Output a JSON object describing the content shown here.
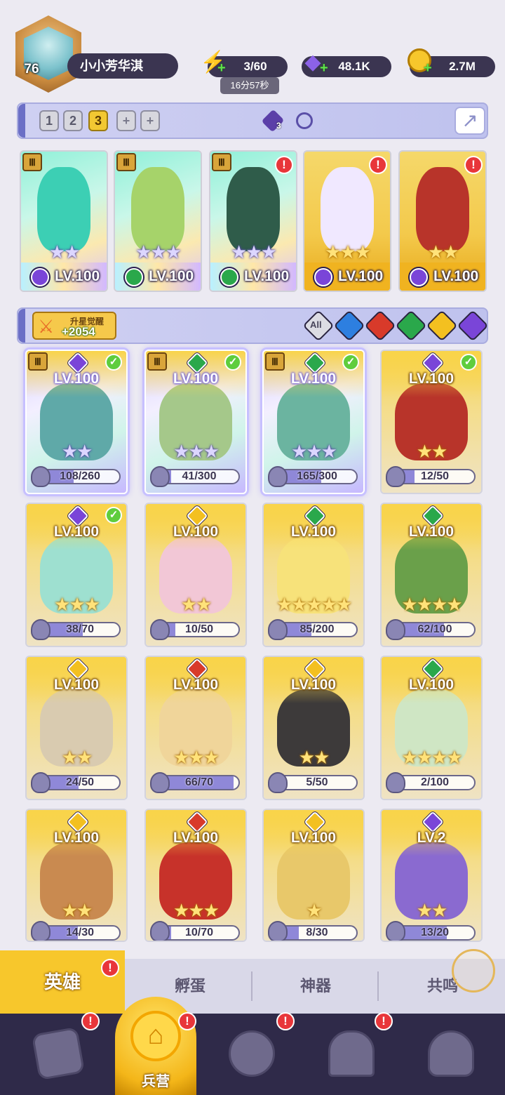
{
  "player": {
    "level": "76",
    "name": "小小芳华淇"
  },
  "resources": {
    "energy": {
      "value": "3/60",
      "timer": "16分57秒",
      "icon": "lightning-icon"
    },
    "gems": {
      "value": "48.1K",
      "icon": "diamond-icon"
    },
    "coins": {
      "value": "2.7M",
      "icon": "coin-icon"
    }
  },
  "team_bar": {
    "slots": [
      "1",
      "2",
      "3"
    ],
    "active_slot": "3",
    "add_icon": "+",
    "gem_count": "3"
  },
  "team": [
    {
      "level": "LV.100",
      "stars": "★★",
      "rank": "Ⅲ",
      "alert": "",
      "style": "holo",
      "element": "#7a45d8",
      "tint": "#3ccfb4"
    },
    {
      "level": "LV.100",
      "stars": "★★★",
      "rank": "Ⅲ",
      "alert": "",
      "style": "holo",
      "element": "#2aa84b",
      "tint": "#a6d36a"
    },
    {
      "level": "LV.100",
      "stars": "★★★",
      "rank": "Ⅲ",
      "alert": "!",
      "style": "holo",
      "element": "#2aa84b",
      "tint": "#2f5c4a"
    },
    {
      "level": "LV.100",
      "stars": "★★★",
      "rank": "",
      "alert": "!",
      "style": "gold",
      "element": "#7a45d8",
      "tint": "#f0e8ff"
    },
    {
      "level": "LV.100",
      "stars": "★★",
      "rank": "",
      "alert": "!",
      "style": "gold",
      "element": "#7a45d8",
      "tint": "#b8342a"
    }
  ],
  "filter_bar": {
    "awaken_label": "升星觉醒",
    "awaken_value": "+2054",
    "all_label": "All",
    "elements": [
      "#2d7fe0",
      "#d83a2a",
      "#2aa84b",
      "#f3c020",
      "#7a45d8"
    ]
  },
  "heroes": [
    {
      "level": "LV.100",
      "stars": "★★",
      "shards": "108/260",
      "fill": 0.42,
      "rank": "Ⅲ",
      "checked": true,
      "style": "holo",
      "element": "#7a45d8",
      "tint": "#5fa9a8"
    },
    {
      "level": "LV.100",
      "stars": "★★★",
      "shards": "41/300",
      "fill": 0.14,
      "rank": "Ⅲ",
      "checked": true,
      "style": "holo",
      "element": "#2aa84b",
      "tint": "#a5c88a"
    },
    {
      "level": "LV.100",
      "stars": "★★★",
      "shards": "165/300",
      "fill": 0.55,
      "rank": "Ⅲ",
      "checked": true,
      "style": "holo",
      "element": "#2aa84b",
      "tint": "#6bb4a0"
    },
    {
      "level": "LV.100",
      "stars": "★★",
      "shards": "12/50",
      "fill": 0.24,
      "rank": "",
      "checked": true,
      "style": "gold",
      "element": "#7a45d8",
      "tint": "#b8342a"
    },
    {
      "level": "LV.100",
      "stars": "★★★",
      "shards": "38/70",
      "fill": 0.54,
      "rank": "",
      "checked": true,
      "style": "gold",
      "element": "#7a45d8",
      "tint": "#9ee0d0"
    },
    {
      "level": "LV.100",
      "stars": "★★",
      "shards": "10/50",
      "fill": 0.2,
      "rank": "",
      "checked": false,
      "style": "gold",
      "element": "#f3c020",
      "tint": "#f2c7d6"
    },
    {
      "level": "LV.100",
      "stars": "★★★★★",
      "shards": "85/200",
      "fill": 0.43,
      "rank": "",
      "checked": false,
      "style": "gold",
      "element": "#2aa84b",
      "tint": "#f7e27a"
    },
    {
      "level": "LV.100",
      "stars": "★★★★",
      "shards": "62/100",
      "fill": 0.62,
      "rank": "",
      "checked": false,
      "style": "gold",
      "element": "#2aa84b",
      "tint": "#6aa04a"
    },
    {
      "level": "LV.100",
      "stars": "★★",
      "shards": "24/50",
      "fill": 0.48,
      "rank": "",
      "checked": false,
      "style": "gold",
      "element": "#f3c020",
      "tint": "#d9cbb0"
    },
    {
      "level": "LV.100",
      "stars": "★★★",
      "shards": "66/70",
      "fill": 0.94,
      "rank": "",
      "checked": false,
      "style": "gold",
      "element": "#d83a2a",
      "tint": "#f0d59a"
    },
    {
      "level": "LV.100",
      "stars": "★★",
      "shards": "5/50",
      "fill": 0.1,
      "rank": "",
      "checked": false,
      "style": "gold",
      "element": "#f3c020",
      "tint": "#3d3a3a"
    },
    {
      "level": "LV.100",
      "stars": "★★★★",
      "shards": "2/100",
      "fill": 0.02,
      "rank": "",
      "checked": false,
      "style": "gold",
      "element": "#2aa84b",
      "tint": "#cfe6c4"
    },
    {
      "level": "LV.100",
      "stars": "★★",
      "shards": "14/30",
      "fill": 0.47,
      "rank": "",
      "checked": false,
      "style": "gold",
      "element": "#f3c020",
      "tint": "#c98a50"
    },
    {
      "level": "LV.100",
      "stars": "★★★",
      "shards": "10/70",
      "fill": 0.14,
      "rank": "",
      "checked": false,
      "style": "gold",
      "element": "#d83a2a",
      "tint": "#c7322a"
    },
    {
      "level": "LV.100",
      "stars": "★",
      "shards": "8/30",
      "fill": 0.27,
      "rank": "",
      "checked": false,
      "style": "gold",
      "element": "#f3c020",
      "tint": "#e8c86a"
    },
    {
      "level": "LV.2",
      "stars": "★★",
      "shards": "13/20",
      "fill": 0.65,
      "rank": "",
      "checked": false,
      "style": "gold",
      "element": "#7a45d8",
      "tint": "#8a6ad0"
    }
  ],
  "subtabs": [
    {
      "label": "英雄",
      "active": true,
      "alert": "!"
    },
    {
      "label": "孵蛋",
      "active": false
    },
    {
      "label": "神器",
      "active": false
    },
    {
      "label": "共鸣",
      "active": false
    }
  ],
  "bottom_nav": {
    "active_label": "兵营",
    "alert": "!",
    "items": [
      "cards-icon",
      "barracks-icon",
      "map-icon",
      "temple-icon",
      "mushroom-icon"
    ]
  },
  "colors": {
    "gold": "#f7c72c",
    "nav_bg": "#2f2a49",
    "pill_bg": "#3b3551"
  }
}
